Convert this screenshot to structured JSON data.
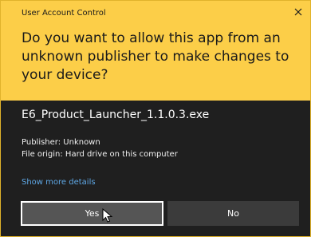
{
  "dialog": {
    "title": "User Account Control",
    "question": "Do you want to allow this app from an unknown publisher to make changes to your device?",
    "app_name": "E6_Product_Launcher_1.1.0.3.exe",
    "publisher": "Publisher: Unknown",
    "file_origin": "File origin: Hard drive on this computer",
    "details_link": "Show more details",
    "yes_label": "Yes",
    "no_label": "No",
    "close_icon": "close-icon"
  },
  "colors": {
    "header_background": "#fcce48",
    "body_background": "#1f1f1f",
    "link": "#5fa8e6",
    "yes_button": "#555555",
    "no_button": "#3b3b3b"
  }
}
